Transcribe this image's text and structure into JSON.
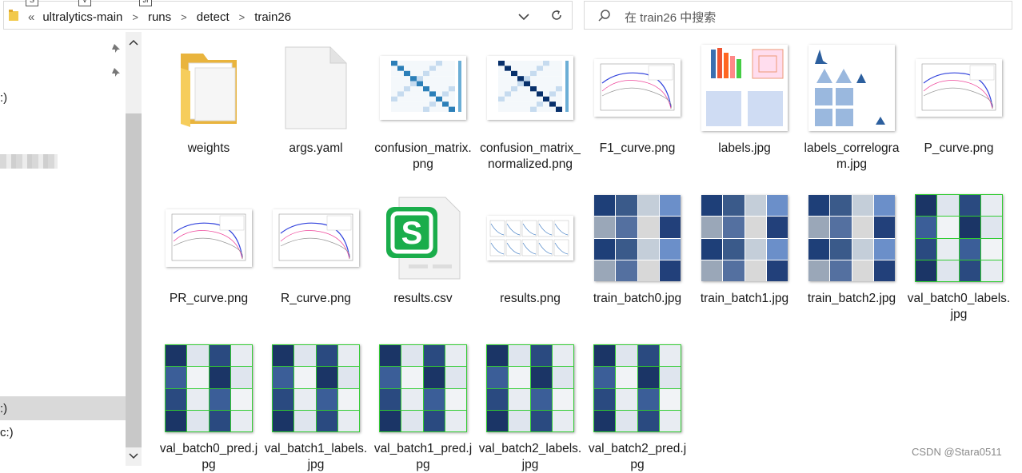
{
  "address_bar": {
    "overflow_chevron": "«",
    "crumbs": [
      "ultralytics-main",
      "runs",
      "detect",
      "train26"
    ],
    "key_tips": [
      "S",
      "V",
      "JI"
    ]
  },
  "search": {
    "placeholder": "在 train26 中搜索"
  },
  "nav_pane": {
    "items": [
      ":)",
      ":)",
      ":)",
      "c:)"
    ]
  },
  "files": [
    {
      "name": "weights",
      "kind": "folder"
    },
    {
      "name": "args.yaml",
      "kind": "file"
    },
    {
      "name": "confusion_matrix.png",
      "kind": "matrix"
    },
    {
      "name": "confusion_matrix_normalized.png",
      "kind": "matrix-norm"
    },
    {
      "name": "F1_curve.png",
      "kind": "curve"
    },
    {
      "name": "labels.jpg",
      "kind": "labels"
    },
    {
      "name": "labels_correlogram.jpg",
      "kind": "correlogram"
    },
    {
      "name": "P_curve.png",
      "kind": "curve"
    },
    {
      "name": "PR_curve.png",
      "kind": "curve"
    },
    {
      "name": "R_curve.png",
      "kind": "curve"
    },
    {
      "name": "results.csv",
      "kind": "csv"
    },
    {
      "name": "results.png",
      "kind": "results"
    },
    {
      "name": "train_batch0.jpg",
      "kind": "batch"
    },
    {
      "name": "train_batch1.jpg",
      "kind": "batch"
    },
    {
      "name": "train_batch2.jpg",
      "kind": "batch"
    },
    {
      "name": "val_batch0_labels.jpg",
      "kind": "val"
    },
    {
      "name": "val_batch0_pred.jpg",
      "kind": "val"
    },
    {
      "name": "val_batch1_labels.jpg",
      "kind": "val"
    },
    {
      "name": "val_batch1_pred.jpg",
      "kind": "val"
    },
    {
      "name": "val_batch2_labels.jpg",
      "kind": "val"
    },
    {
      "name": "val_batch2_pred.jpg",
      "kind": "val"
    }
  ],
  "watermark": "CSDN @Stara0511",
  "colors": {
    "folder": "#f2c94c",
    "csv_green": "#1aad4b",
    "val_border": "#33cc33"
  }
}
